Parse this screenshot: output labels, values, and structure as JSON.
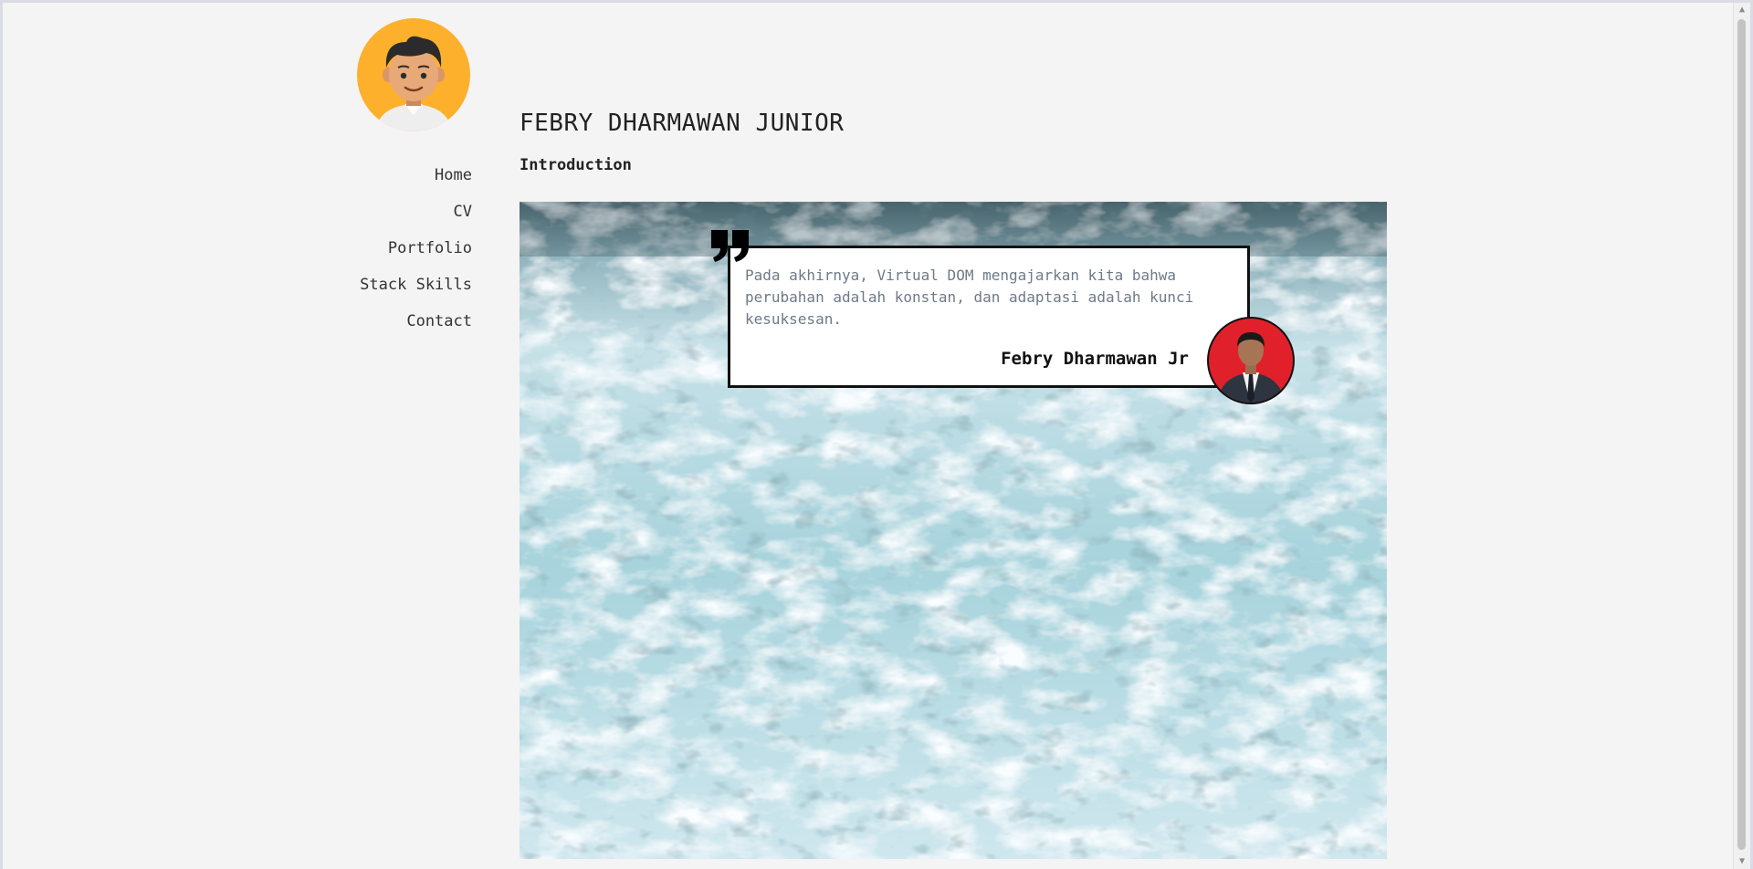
{
  "profile": {
    "name": "FEBRY DHARMAWAN JUNIOR"
  },
  "nav": {
    "items": [
      {
        "label": "Home"
      },
      {
        "label": "CV"
      },
      {
        "label": "Portfolio"
      },
      {
        "label": "Stack Skills"
      },
      {
        "label": "Contact"
      }
    ]
  },
  "main": {
    "section_title": "Introduction",
    "quote": {
      "text": "Pada akhirnya, Virtual DOM mengajarkan kita bahwa perubahan adalah konstan, dan adaptasi adalah kunci kesuksesan.",
      "author": "Febry Dharmawan Jr"
    }
  },
  "colors": {
    "avatar_bg": "#fdb02c",
    "accent_red": "#e0202a",
    "page_bg": "#f4f4f4"
  },
  "icons": {
    "quote": "quote-mark-icon",
    "scroll_up": "chevron-up-icon",
    "scroll_down": "chevron-down-icon"
  }
}
